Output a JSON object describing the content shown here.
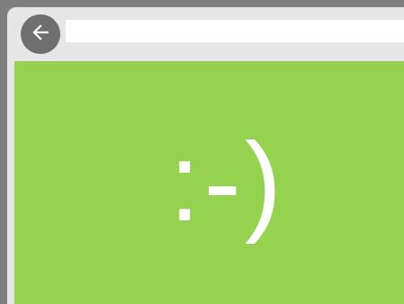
{
  "toolbar": {
    "back_icon": "arrow-left-icon",
    "address_value": "",
    "colors": {
      "background": "#e6e6e6",
      "back_button": "#6f6f6f",
      "address_bar": "#ffffff"
    }
  },
  "content": {
    "text": ":-)",
    "colors": {
      "background": "#95d250",
      "text": "#ffffff"
    }
  },
  "frame": {
    "background": "#7f7f7f"
  }
}
